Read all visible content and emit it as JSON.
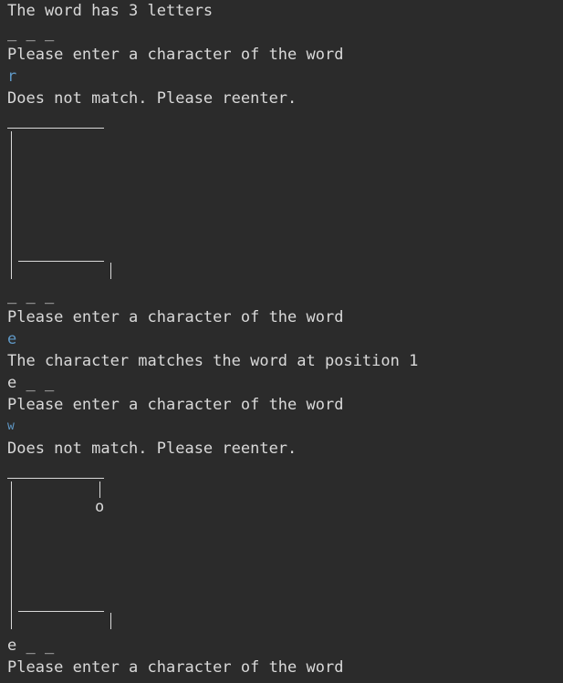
{
  "console": {
    "lines": {
      "intro": "The word has 3 letters",
      "blanks_1": "_ _ _",
      "prompt_1": "Please enter a character of the word",
      "input_1": "r",
      "result_1": "Does not match. Please reenter.",
      "blanks_2": "_ _ _",
      "prompt_2": "Please enter a character of the word",
      "input_2": "e",
      "result_2": "The character matches the word at position 1",
      "blanks_3": "e _ _",
      "prompt_3": "Please enter a character of the word",
      "input_3": "w",
      "result_3": "Does not match. Please reenter.",
      "head_glyph": "o",
      "blanks_4": "e _ _",
      "prompt_4": "Please enter a character of the word"
    }
  },
  "colors": {
    "background": "#2b2b2b",
    "text": "#d9d9d9",
    "user_input": "#5f98c6"
  }
}
